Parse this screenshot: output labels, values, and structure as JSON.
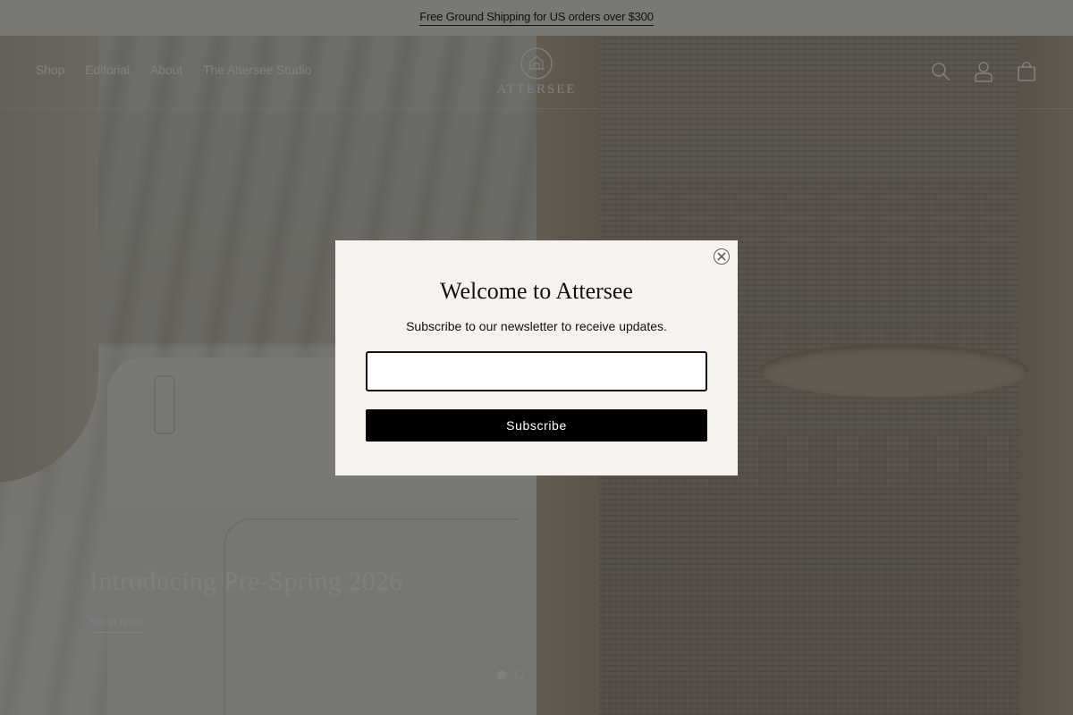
{
  "announcement": {
    "text": "Free Ground Shipping for US orders over $300"
  },
  "header": {
    "nav": [
      "Shop",
      "Editorial",
      "About",
      "The Attersee Studio"
    ],
    "logo_text": "ATTERSEE",
    "icons": [
      "search-icon",
      "account-icon",
      "cart-icon"
    ]
  },
  "hero": {
    "title": "Introducing Pre-Spring 2026",
    "cta": "Shop Now",
    "slides": {
      "count": 2,
      "active": 1
    }
  },
  "modal": {
    "title": "Welcome to Attersee",
    "subtitle": "Subscribe to our newsletter to receive updates.",
    "email_value": "",
    "email_placeholder": "",
    "button_label": "Subscribe",
    "close_icon": "close-icon"
  }
}
